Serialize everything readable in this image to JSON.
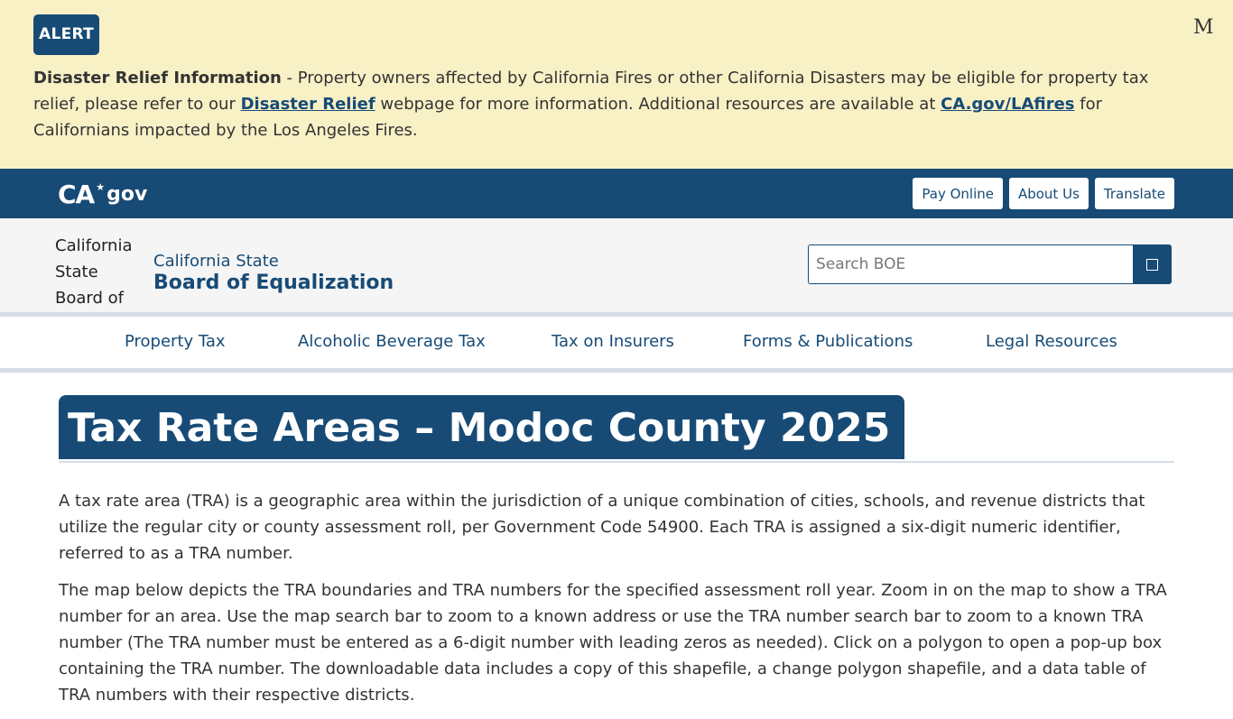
{
  "alert": {
    "badge": "ALERT",
    "close_label": "M",
    "bold_lead": "Disaster Relief Information",
    "text_1": " - Property owners affected by California Fires or other California Disasters may be eligible for property tax relief, please refer to our ",
    "link_1": "Disaster Relief",
    "text_2": " webpage for more information. Additional resources are available at ",
    "link_2": "CA.gov/LAfires",
    "text_3": " for Californians impacted by the Los Angeles Fires."
  },
  "utility": {
    "logo_ca": "CA",
    "logo_gov": "gov",
    "buttons": [
      "Pay Online",
      "About Us",
      "Translate"
    ]
  },
  "branding": {
    "img_alt": "California State Board of",
    "line1": "California State",
    "line2": "Board of Equalization",
    "search_placeholder": "Search BOE"
  },
  "nav": {
    "items": [
      "Property Tax",
      "Alcoholic Beverage Tax",
      "Tax on Insurers",
      "Forms & Publications",
      "Legal Resources"
    ]
  },
  "main": {
    "title": "Tax Rate Areas – Modoc County 2025",
    "paragraphs": [
      "A tax rate area (TRA) is a geographic area within the jurisdiction of a unique combination of cities, schools, and revenue districts that utilize the regular city or county assessment roll, per Government Code 54900. Each TRA is assigned a six-digit numeric identifier, referred to as a TRA number.",
      "The map below depicts the TRA boundaries and TRA numbers for the specified assessment roll year. Zoom in on the map to show a TRA number for an area. Use the map search bar to zoom to a known address or use the TRA number search bar to zoom to a known TRA number (The TRA number must be entered as a 6-digit number with leading zeros as needed). Click on a polygon to open a pop-up box containing the TRA number. The downloadable data includes a copy of this shapefile, a change polygon shapefile, and a data table of TRA numbers with their respective districts."
    ]
  },
  "colors": {
    "primary": "#174b76",
    "alert_bg": "#f9f1c6",
    "branding_bg": "#f5f5f5",
    "border": "#d6dde6"
  }
}
